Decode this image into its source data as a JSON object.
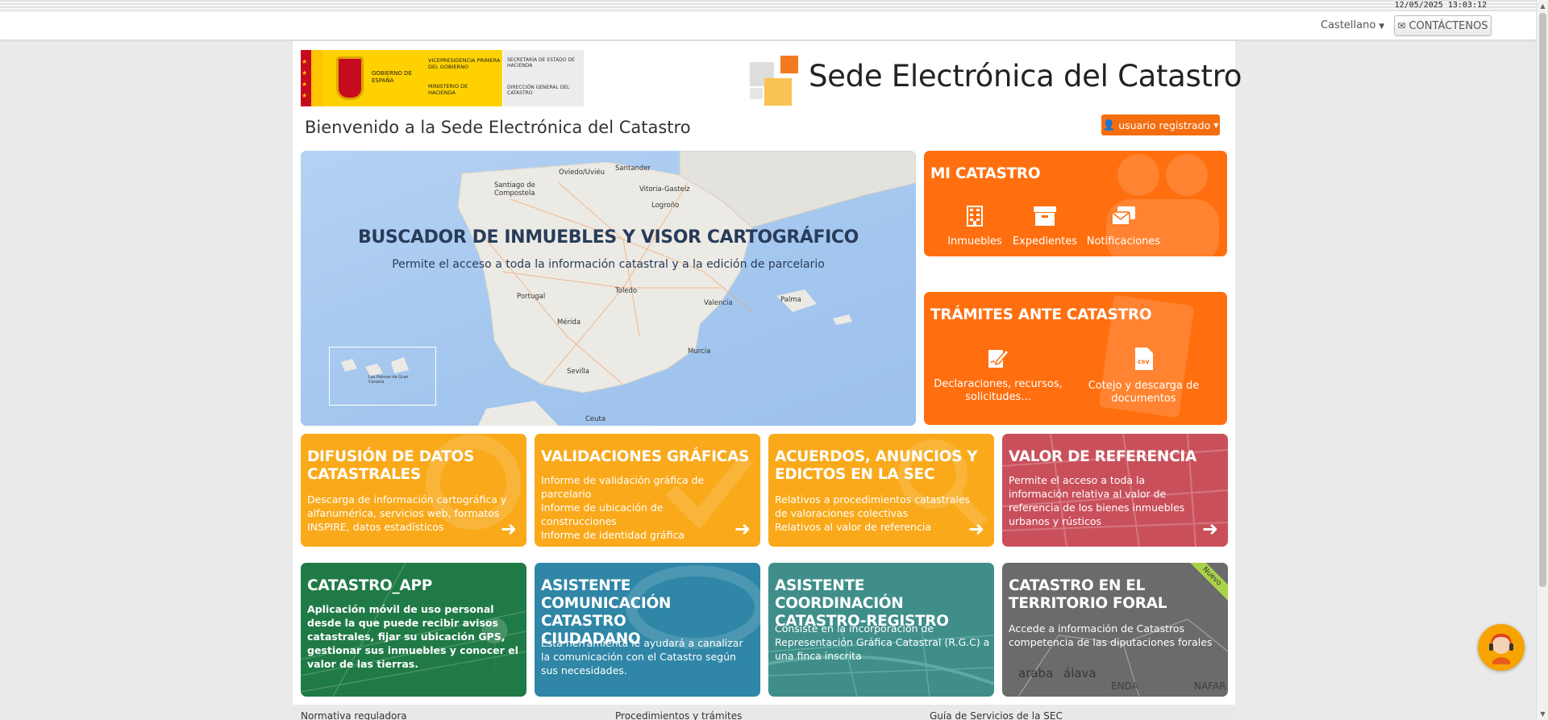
{
  "clock": "12/05/2025  13:03:12",
  "navbar": {
    "language": "Castellano",
    "contact_label": "CONTÁCTENOS"
  },
  "logos": {
    "gov_line1": "GOBIERNO DE ESPAÑA",
    "gov_line2": "VICEPRESIDENCIA PRIMERA DEL GOBIERNO",
    "gov_line3": "MINISTERIO DE HACIENDA",
    "gov_line4": "SECRETARÍA DE ESTADO DE HACIENDA",
    "gov_line5": "DIRECCIÓN GENERAL DEL CATASTRO"
  },
  "site_title": "Sede Electrónica del Catastro",
  "welcome": "Bienvenido a la Sede Electrónica del Catastro",
  "user_button": "usuario registrado",
  "map_tile": {
    "title": "BUSCADOR DE INMUEBLES Y VISOR CARTOGRÁFICO",
    "subtitle": "Permite el acceso a toda la información catastral y a la edición de parcelario",
    "cities": [
      "Oviedo/Uviéu",
      "Santander",
      "Santiago de Compostela",
      "Vitoria-Gasteiz",
      "Logroño",
      "Portugal",
      "Toledo",
      "Valencia",
      "Palma",
      "Mérida",
      "Murcia",
      "Sevilla",
      "Ceuta",
      "Las Palmas de Gran Canaria"
    ]
  },
  "mi_catastro": {
    "title": "MI CATASTRO",
    "items": [
      {
        "label": "Inmuebles",
        "icon": "building-icon"
      },
      {
        "label": "Expedientes",
        "icon": "archive-box-icon"
      },
      {
        "label": "Notificaciones",
        "icon": "notifications-icon"
      }
    ]
  },
  "tramites": {
    "title": "TRÁMITES ANTE CATASTRO",
    "items": [
      {
        "label": "Declaraciones, recursos, solicitudes...",
        "icon": "edit-document-icon"
      },
      {
        "label": "Cotejo y descarga de documentos",
        "icon": "csv-file-icon"
      }
    ]
  },
  "row1": [
    {
      "title": "DIFUSIÓN DE DATOS CATASTRALES",
      "desc": "Descarga de información cartográfica y alfanumérica, servicios web, formatos INSPIRE, datos estadísticos",
      "color": "#f9a91a"
    },
    {
      "title": "VALIDACIONES GRÁFICAS",
      "desc": "Informe de validación gráfica de parcelario\nInforme de ubicación de construcciones\nInforme de identidad gráfica",
      "color": "#f9a91a"
    },
    {
      "title": "ACUERDOS, ANUNCIOS Y EDICTOS EN LA SEC",
      "desc": "Relativos a procedimientos catastrales de valoraciones colectivas\nRelativos al valor de referencia",
      "color": "#f9a91a"
    },
    {
      "title": "VALOR DE REFERENCIA",
      "desc": "Permite el acceso a toda la información relativa al valor de referencia de los bienes inmuebles urbanos y rústicos",
      "color": "#c9505b"
    }
  ],
  "row2": [
    {
      "title": "CATASTRO_APP",
      "desc": "Aplicación móvil de uso personal desde la que puede recibir avisos catastrales, fijar su ubicación GPS, gestionar sus inmuebles y conocer el valor de las tierras.",
      "color": "#1f7a46"
    },
    {
      "title": "ASISTENTE COMUNICACIÓN CATASTRO CIUDADANO",
      "desc": "Esta herramienta le ayudará a canalizar la comunicación con el Catastro según sus necesidades.",
      "color": "#2f86a6"
    },
    {
      "title": "ASISTENTE COORDINACIÓN CATASTRO-REGISTRO",
      "desc": "Consiste en la incorporación de Representación Gráfica Catastral (R.G.C) a una finca inscrita",
      "color": "#3f8e8a"
    },
    {
      "title": "CATASTRO EN EL TERRITORIO FORAL",
      "desc": "Accede a información de Catastros competencia de las diputaciones forales",
      "color": "#6b6b6b",
      "badge": "Nuevo",
      "map_labels": [
        "araba",
        "álava",
        "ENDA",
        "NAFAR"
      ]
    }
  ],
  "footer": [
    "Normativa reguladora",
    "Procedimientos y trámites",
    "Guía de Servicios de la SEC"
  ]
}
